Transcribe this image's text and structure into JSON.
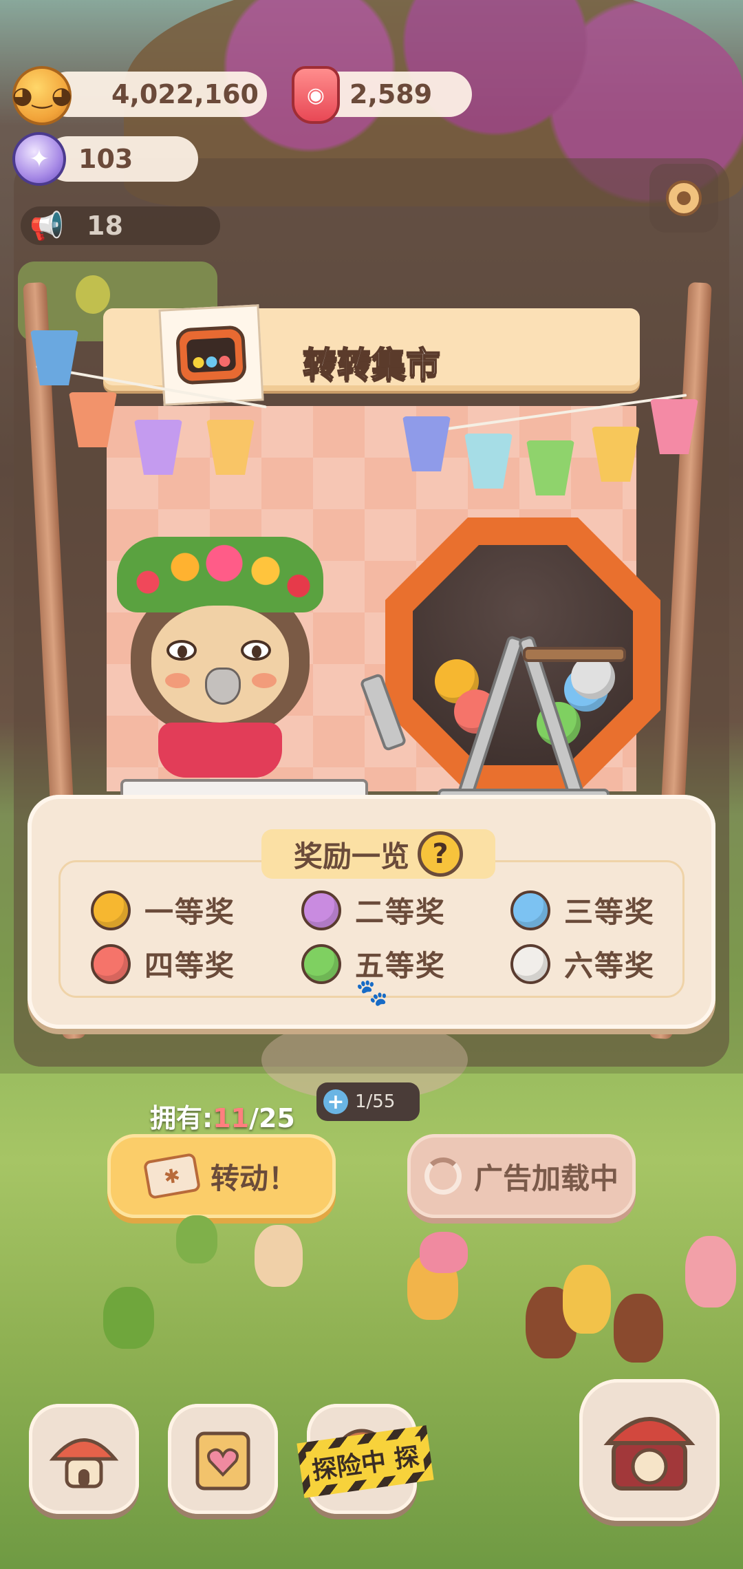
{
  "currency": {
    "coins": "4,022,160",
    "rubies": "2,589",
    "gems": "103"
  },
  "notification": {
    "count": "18"
  },
  "stall": {
    "title": "转转集市"
  },
  "rewards": {
    "title": "奖励一览",
    "help": "?",
    "prizes": [
      {
        "label": "一等奖",
        "color": "#f6b730"
      },
      {
        "label": "二等奖",
        "color": "#c98be0"
      },
      {
        "label": "三等奖",
        "color": "#7cc2f2"
      },
      {
        "label": "四等奖",
        "color": "#f5746a"
      },
      {
        "label": "五等奖",
        "color": "#7fd061"
      },
      {
        "label": "六等奖",
        "color": "#f1eeea"
      }
    ]
  },
  "progress": {
    "value": "1/55"
  },
  "own": {
    "label": "拥有:",
    "current": "11",
    "total": "/25"
  },
  "buttons": {
    "spin": "转动！",
    "ad": "广告加载中"
  },
  "nav": {
    "explore": "探险中 探"
  }
}
